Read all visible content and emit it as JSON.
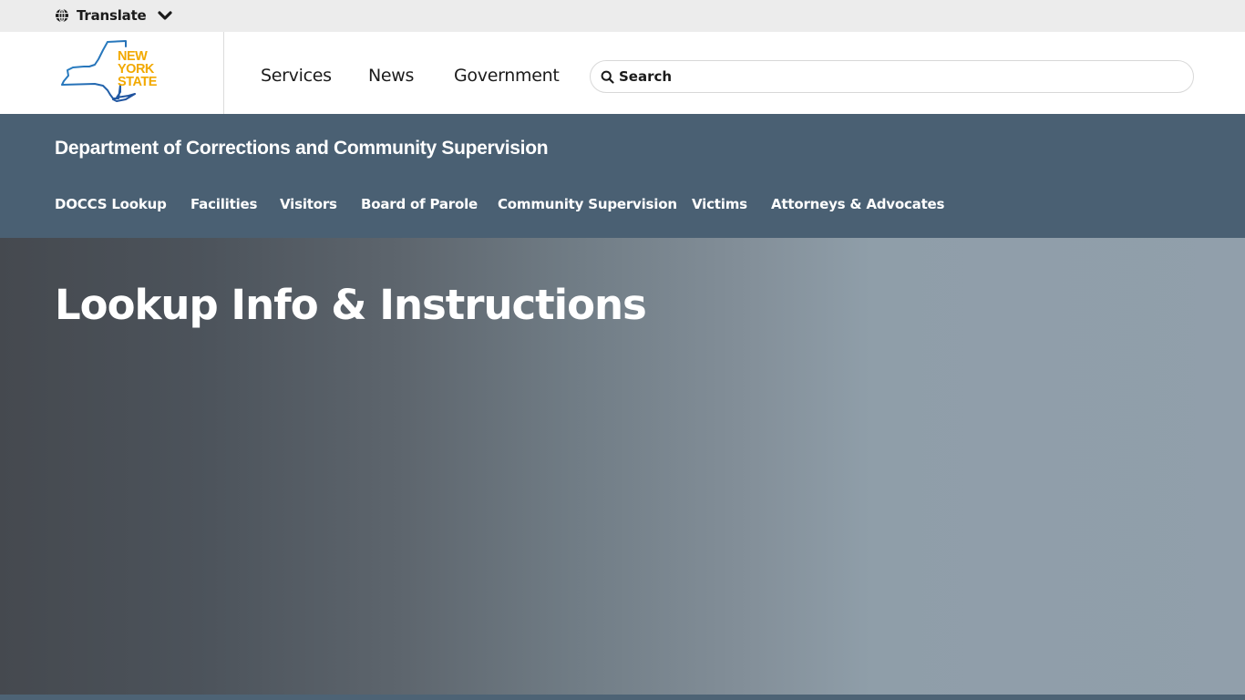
{
  "utility_bar": {
    "translate_label": "Translate",
    "translate_icon": "globe-icon",
    "dropdown_icon": "chevron-down-icon"
  },
  "header": {
    "logo": {
      "lines": [
        "NEW",
        "YORK",
        "STATE"
      ],
      "outline_color": "#2c6fb7",
      "text_color": "#f2a900"
    },
    "nav": [
      {
        "label": "Services"
      },
      {
        "label": "News"
      },
      {
        "label": "Government"
      }
    ],
    "search": {
      "placeholder": "Search",
      "value": "",
      "icon": "search-icon"
    }
  },
  "agency": {
    "title": "Department of Corrections and Community Supervision",
    "band_color": "#4a6073",
    "nav": [
      {
        "label": "DOCCS Lookup"
      },
      {
        "label": "Facilities"
      },
      {
        "label": "Visitors"
      },
      {
        "label": "Board of Parole"
      },
      {
        "label": "Community Supervision"
      },
      {
        "label": "Victims"
      },
      {
        "label": "Attorneys & Advocates"
      }
    ]
  },
  "hero": {
    "title": "Lookup Info & Instructions"
  }
}
